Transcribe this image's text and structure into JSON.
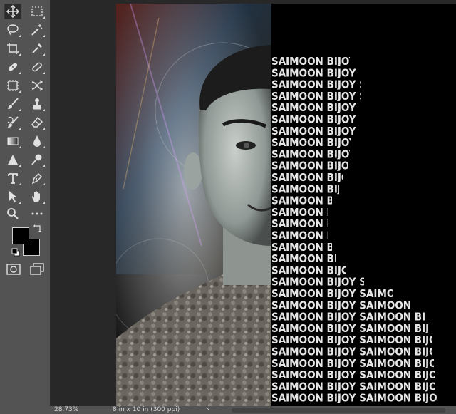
{
  "toolbar": {
    "tools": [
      {
        "id": "move",
        "icon": "move-icon",
        "selected": true
      },
      {
        "id": "marquee",
        "icon": "rectangular-marquee-icon"
      },
      {
        "id": "lasso",
        "icon": "lasso-icon"
      },
      {
        "id": "magic-wand",
        "icon": "magic-wand-icon"
      },
      {
        "id": "crop",
        "icon": "crop-icon"
      },
      {
        "id": "eyedropper",
        "icon": "eyedropper-icon"
      },
      {
        "id": "spot-healing",
        "icon": "bandage-icon"
      },
      {
        "id": "patch",
        "icon": "patch-icon"
      },
      {
        "id": "content-aware-move",
        "icon": "content-aware-move-icon"
      },
      {
        "id": "recompose",
        "icon": "shuffle-icon"
      },
      {
        "id": "brush",
        "icon": "brush-icon"
      },
      {
        "id": "clone-stamp",
        "icon": "stamp-icon"
      },
      {
        "id": "history-brush",
        "icon": "history-brush-icon"
      },
      {
        "id": "eraser",
        "icon": "eraser-icon"
      },
      {
        "id": "gradient",
        "icon": "gradient-icon"
      },
      {
        "id": "blur",
        "icon": "water-drop-icon"
      },
      {
        "id": "sharpen",
        "icon": "triangle-icon"
      },
      {
        "id": "dodge",
        "icon": "dodge-icon"
      },
      {
        "id": "type",
        "icon": "type-icon"
      },
      {
        "id": "pen",
        "icon": "pen-icon"
      },
      {
        "id": "path-selection",
        "icon": "arrow-pointer-icon"
      },
      {
        "id": "hand",
        "icon": "hand-icon"
      },
      {
        "id": "zoom",
        "icon": "zoom-icon"
      },
      {
        "id": "more",
        "icon": "ellipsis-icon"
      }
    ],
    "foreground_color": "#000000",
    "background_color": "#000000"
  },
  "canvas": {
    "repeated_text": "SAIMOON BIJOY"
  },
  "statusbar": {
    "zoom": "28.73%",
    "doc_info": "8 in x 10 in (300 ppi)",
    "arrow": "›"
  }
}
